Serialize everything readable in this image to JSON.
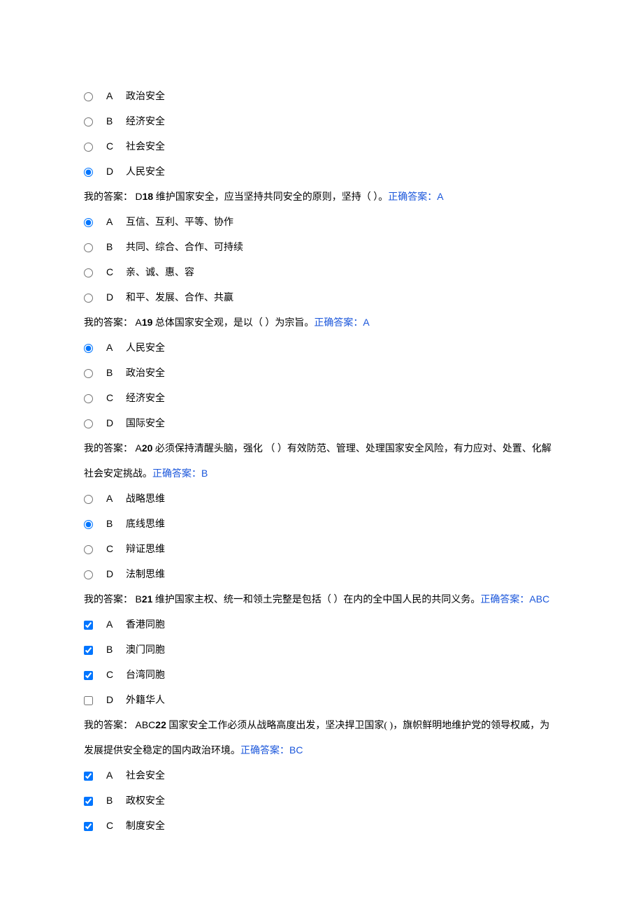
{
  "labels": {
    "my_answer_prefix": "我的答案：",
    "correct_prefix": "正确答案："
  },
  "q17": {
    "options": [
      {
        "letter": "A",
        "text": "政治安全",
        "checked": false
      },
      {
        "letter": "B",
        "text": "经济安全",
        "checked": false
      },
      {
        "letter": "C",
        "text": "社会安全",
        "checked": false
      },
      {
        "letter": "D",
        "text": "人民安全",
        "checked": true
      }
    ],
    "my_answer": "D"
  },
  "q18": {
    "number": "18",
    "stem": " 维护国家安全，应当坚持共同安全的原则，坚持（  ）。",
    "correct": "A",
    "options": [
      {
        "letter": "A",
        "text": "互信、互利、平等、协作",
        "checked": true
      },
      {
        "letter": "B",
        "text": "共同、综合、合作、可持续",
        "checked": false
      },
      {
        "letter": "C",
        "text": "亲、诚、惠、容",
        "checked": false
      },
      {
        "letter": "D",
        "text": "和平、发展、合作、共赢",
        "checked": false
      }
    ],
    "my_answer": "A"
  },
  "q19": {
    "number": "19",
    "stem": " 总体国家安全观，是以（  ）为宗旨。",
    "correct": "A",
    "options": [
      {
        "letter": "A",
        "text": "人民安全",
        "checked": true
      },
      {
        "letter": "B",
        "text": "政治安全",
        "checked": false
      },
      {
        "letter": "C",
        "text": "经济安全",
        "checked": false
      },
      {
        "letter": "D",
        "text": "国际安全",
        "checked": false
      }
    ],
    "my_answer": "A"
  },
  "q20": {
    "number": "20",
    "stem": " 必须保持清醒头脑，强化 （  ）有效防范、管理、处理国家安全风险，有力应对、处置、化解社会安定挑战。",
    "correct": "B",
    "options": [
      {
        "letter": "A",
        "text": "战略思维",
        "checked": false
      },
      {
        "letter": "B",
        "text": "底线思维",
        "checked": true
      },
      {
        "letter": "C",
        "text": "辩证思维",
        "checked": false
      },
      {
        "letter": "D",
        "text": "法制思维",
        "checked": false
      }
    ],
    "my_answer": "B"
  },
  "q21": {
    "number": "21",
    "stem": " 维护国家主权、统一和领土完整是包括（  ）在内的全中国人民的共同义务。",
    "correct": "ABC",
    "options": [
      {
        "letter": "A",
        "text": "香港同胞",
        "checked": true
      },
      {
        "letter": "B",
        "text": "澳门同胞",
        "checked": true
      },
      {
        "letter": "C",
        "text": "台湾同胞",
        "checked": true
      },
      {
        "letter": "D",
        "text": "外籍华人",
        "checked": false
      }
    ],
    "my_answer": "ABC"
  },
  "q22": {
    "number": "22",
    "stem": " 国家安全工作必须从战略高度出发，坚决捍卫国家(  )，旗帜鲜明地维护党的领导权威，为发展提供安全稳定的国内政治环境。",
    "correct": "BC",
    "options": [
      {
        "letter": "A",
        "text": "社会安全",
        "checked": true
      },
      {
        "letter": "B",
        "text": "政权安全",
        "checked": true
      },
      {
        "letter": "C",
        "text": "制度安全",
        "checked": true
      }
    ]
  }
}
